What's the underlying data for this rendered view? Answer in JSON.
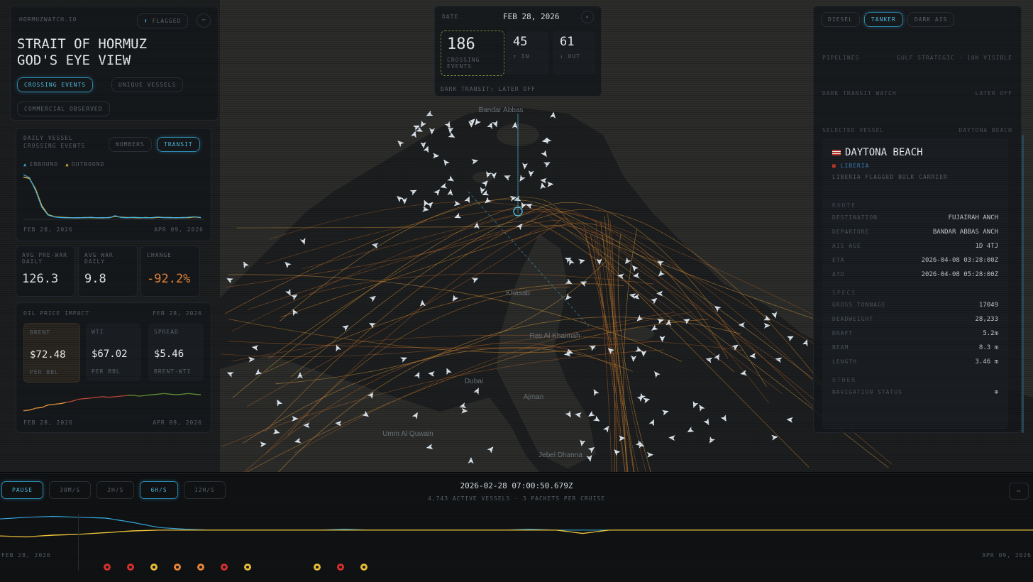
{
  "app": {
    "brand": "HORMUZWATCH.IO",
    "flag_btn": "FLAGGED",
    "title_line1": "STRAIT OF HORMUZ",
    "title_line2": "GOD'S EYE VIEW",
    "filters": [
      "CROSSING EVENTS",
      "UNIQUE VESSELS",
      "COMMERCIAL OBSERVED"
    ]
  },
  "left_chart": {
    "label": "DAILY VESSEL CROSSING EVENTS",
    "toggles": [
      "NUMBERS",
      "TRANSIT"
    ],
    "legend": [
      "INBOUND",
      "OUTBOUND"
    ],
    "date_start": "FEB 28, 2026",
    "date_end": "APR 09, 2026",
    "inbound": [
      148,
      138,
      95,
      40,
      14,
      8,
      6,
      5,
      5,
      6,
      5,
      7,
      5,
      6,
      5,
      12,
      6,
      5,
      7,
      6,
      5,
      6,
      8,
      6,
      5,
      6,
      5,
      7,
      9,
      6
    ],
    "outbound": [
      140,
      135,
      100,
      45,
      16,
      9,
      7,
      6,
      5,
      5,
      6,
      6,
      5,
      5,
      6,
      10,
      7,
      6,
      6,
      5,
      6,
      5,
      7,
      6,
      6,
      5,
      6,
      6,
      8,
      6
    ],
    "ylim": [
      0,
      160
    ]
  },
  "stats": [
    {
      "label": "AVG PRE-WAR DAILY",
      "value": "126.3",
      "color": "#e6ebee"
    },
    {
      "label": "AVG WAR DAILY",
      "value": "9.8",
      "color": "#e6ebee"
    },
    {
      "label": "CHANGE",
      "value": "-92.2%",
      "color": "#f08a3c"
    }
  ],
  "oil": {
    "label": "OIL PRICE IMPACT",
    "date": "FEB 28, 2026",
    "cards": [
      {
        "label": "BRENT",
        "value": "$72.48",
        "sub": "PER BBL"
      },
      {
        "label": "WTI",
        "value": "$67.02",
        "sub": "PER BBL"
      },
      {
        "label": "SPREAD",
        "value": "$5.46",
        "sub": "BRENT-WTI"
      }
    ],
    "date_start": "FEB 28, 2026",
    "date_end": "APR 09, 2026",
    "series": [
      62,
      63,
      66,
      67,
      71,
      72,
      73,
      75,
      77,
      80,
      81,
      82,
      83,
      84,
      83,
      84,
      85,
      86,
      86,
      85,
      86,
      87,
      88,
      89,
      88,
      87,
      88,
      89,
      88,
      87
    ],
    "ylim": [
      55,
      95
    ]
  },
  "top_counter": {
    "label": "DATE",
    "date": "FEB 28, 2026",
    "crossing": "186",
    "crossing_label": "CROSSING EVENTS",
    "in": "45",
    "in_label": "IN",
    "out": "61",
    "out_label": "OUT",
    "note": "DARK TRANSIT: LATER OFF"
  },
  "right": {
    "tabs": [
      "DIESEL",
      "TANKER",
      "DARK AIS"
    ],
    "rows": [
      {
        "k": "PIPELINES",
        "v": "GULF STRATEGIC · 10K VISIBLE"
      },
      {
        "k": "DARK TRANSIT WATCH",
        "v": "LATER OFF"
      }
    ],
    "selected_label": "SELECTED VESSEL",
    "selected_name_small": "DAYTONA BEACH"
  },
  "vessel": {
    "name": "DAYTONA BEACH",
    "flag": "LIBERIA",
    "desc": "LIBERIA FLAGGED BULK CARRIER",
    "route_section": "ROUTE",
    "route": [
      {
        "k": "DESTINATION",
        "v": "FUJAIRAH ANCH"
      },
      {
        "k": "DEPARTURE",
        "v": "BANDAR ABBAS ANCH"
      },
      {
        "k": "AIS AGE",
        "v": "1D 4TJ"
      },
      {
        "k": "ETA",
        "v": "2026-04-08 03:28:00Z"
      },
      {
        "k": "ATD",
        "v": "2026-04-08 05:28:00Z"
      }
    ],
    "specs_section": "SPECS",
    "specs": [
      {
        "k": "GROSS TONNAGE",
        "v": "17049"
      },
      {
        "k": "DEADWEIGHT",
        "v": "28,233"
      },
      {
        "k": "DRAFT",
        "v": "5.2m"
      },
      {
        "k": "BEAM",
        "v": "8.3 m"
      },
      {
        "k": "LENGTH",
        "v": "3.46 m"
      }
    ],
    "other_section": "OTHER",
    "other": [
      {
        "k": "NAVIGATION STATUS",
        "v": "⊕"
      }
    ]
  },
  "places": [
    {
      "name": "Bandar Abbas"
    },
    {
      "name": "Khasab"
    },
    {
      "name": "Ras Al Khaimah"
    },
    {
      "name": "Dubai"
    },
    {
      "name": "Ajman"
    },
    {
      "name": "Umm Al Quwain"
    },
    {
      "name": "Jebel Dhanna"
    }
  ],
  "timeline": {
    "buttons": [
      "PAUSE",
      "30M/S",
      "2H/S",
      "6H/S",
      "12H/S"
    ],
    "active": 3,
    "timestamp": "2026-02-28 07:00:50.679Z",
    "sub": "4,743 ACTIVE VESSELS · 3 PACKETS PER CRUISE",
    "date_start": "FEB 28, 2026",
    "date_end": "APR 09, 2026",
    "series_a": [
      14,
      16,
      17,
      16,
      15,
      10,
      4,
      2,
      1,
      1,
      1,
      1,
      1,
      2,
      1,
      1,
      1,
      1,
      1,
      1,
      2,
      1,
      1,
      1,
      1,
      1,
      1,
      1,
      1,
      1,
      1,
      1,
      1,
      1,
      1,
      1,
      1,
      1,
      1,
      1
    ],
    "series_b": [
      -6,
      -7,
      -5,
      -4,
      -2,
      0,
      1,
      1,
      1,
      1,
      1,
      1,
      1,
      1,
      1,
      1,
      1,
      1,
      1,
      1,
      1,
      1,
      -3,
      1,
      1,
      1,
      1,
      1,
      1,
      1,
      1,
      1,
      1,
      1,
      1,
      1,
      1,
      1,
      1,
      1
    ],
    "events": [
      "#e0322e",
      "#e0322e",
      "#f0c43a",
      "#f08a3c",
      "#f08a3c",
      "#e0322e",
      "#f0c43a",
      "#f0c43a",
      "#e0322e",
      "#f0c43a"
    ]
  },
  "colors": {
    "accent": "#4fc3e8",
    "inbound": "#3ab0e8",
    "outbound": "#f0c43a",
    "orange": "#f08a3c"
  }
}
